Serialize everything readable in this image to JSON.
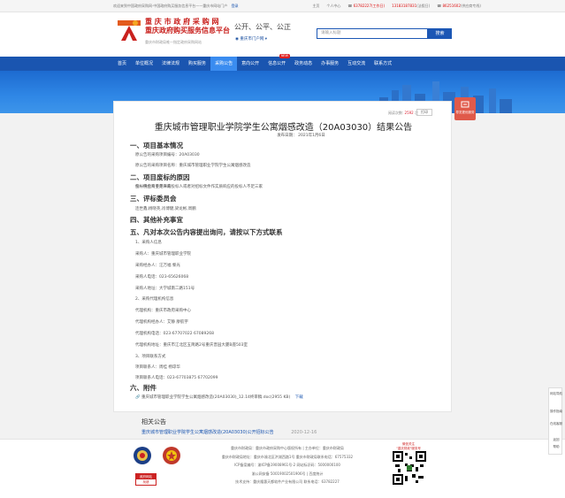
{
  "topbar": {
    "welcome": "欢迎来到中国政府采购网·中国政府购买服务信息平台——重庆市网站门户",
    "login": "登录",
    "links": [
      "主页",
      "个人中心"
    ],
    "tel1": "63782227(工作日)",
    "tel2": "13183187831",
    "tel2_note": "(法假日)",
    "tel3": "86251602",
    "tel3_note": "(供应商专线)"
  },
  "header": {
    "logo_line1": "重 庆 市 政 府 采 购 网",
    "logo_line2": "重庆政府购买服务信息平台",
    "logo_line3": "重庆市财政局唯一指定政府采购网站",
    "slogan": "公开、公平、公正",
    "region": "◉ 重庆市门户网 ▾",
    "search_placeholder": "请输入标题",
    "search_button": "搜索"
  },
  "nav": {
    "items": [
      {
        "label": "首页",
        "active": false
      },
      {
        "label": "单位概况",
        "active": false
      },
      {
        "label": "法律法规",
        "active": false
      },
      {
        "label": "购买服务",
        "active": false
      },
      {
        "label": "采购公告",
        "active": true
      },
      {
        "label": "意向公开",
        "active": false
      },
      {
        "label": "信息公开",
        "active": false,
        "badge": "NEW"
      },
      {
        "label": "政务动态",
        "active": false
      },
      {
        "label": "办事服务",
        "active": false
      },
      {
        "label": "互动交流",
        "active": false
      },
      {
        "label": "联系方式",
        "active": false
      }
    ]
  },
  "article": {
    "views_label": "阅读次数: ",
    "views_count": "2592",
    "views_unit": " 次",
    "print_button": "打印",
    "title": "重庆城市管理职业学院学生公寓烟感改造（20A03030）结果公告",
    "pubdate": "发布日期： 2021年1月6日",
    "sections": [
      {
        "type": "sec",
        "text": "一、项目基本情况"
      },
      {
        "type": "txt",
        "text": "原公告的采购项目编号：20A03030"
      },
      {
        "type": "txt",
        "text": "原公告的采购项目名称：重庆城市管理职业学院学生公寓烟感改造"
      },
      {
        "type": "sec",
        "text": "二、项目废标的原因"
      },
      {
        "type": "txt",
        "text": "投标供应商不足三家"
      },
      {
        "type": "txt",
        "text": "包一符合专业条件的投标人或者对招标文件作实质响应的投标人不足三家"
      },
      {
        "type": "sec",
        "text": "三、评标委员会"
      },
      {
        "type": "txt",
        "text": "连世鑫,杨晓英,肖博健,梁龙彬,周鹏"
      },
      {
        "type": "sec",
        "text": "四、其他补充事宜"
      },
      {
        "type": "sec",
        "text": "五、凡对本次公告内容提出询问，请按以下方式联系"
      },
      {
        "type": "txt2",
        "text": "1、采购人信息"
      },
      {
        "type": "txt2",
        "text": "采购人：重庆城市管理职业学院"
      },
      {
        "type": "txt2",
        "text": "采购经办人：汪万福 黎光"
      },
      {
        "type": "txt2",
        "text": "采购人电话：023-65626068"
      },
      {
        "type": "txt2",
        "text": "采购人地址：大学城南二路151号"
      },
      {
        "type": "txt2",
        "text": "2、采购代理机构信息"
      },
      {
        "type": "txt2",
        "text": "代理机构：重庆市政府采购中心"
      },
      {
        "type": "txt2",
        "text": "代理机构经办人：艾静 廖航宇"
      },
      {
        "type": "txt2",
        "text": "代理机构电话：023-67707022 67089268"
      },
      {
        "type": "txt2",
        "text": "代理机构地址：重庆市江北区五简路2号重庆晋园大厦B座503室"
      },
      {
        "type": "txt2",
        "text": "3、项目联系方式"
      },
      {
        "type": "txt2",
        "text": "项目联系人：周桂 杨琼华"
      },
      {
        "type": "txt2",
        "text": "项目联系人电话：023-67703875 67702099"
      },
      {
        "type": "sec",
        "text": "六、附件"
      }
    ],
    "attachment": {
      "name": "重庆城市管理职业学院学生公寓烟感改造(20A03030)_12.14终审稿.doc(2955 KB)",
      "download": "下载"
    }
  },
  "related": {
    "title": "相关公告",
    "items": [
      {
        "link": "重庆城市管理职业学院学生公寓烟感改造(20A03030)公开招标公告",
        "date": "2020-12-16"
      }
    ]
  },
  "footer": {
    "lines": [
      "重庆市财政局：重庆市政府采购中心版权所有 | 主办单位：重庆市财政局",
      "重庆市财政局地址：重庆市渝北区洪湖西路1号 重庆市财政局联系电话：67575332",
      "ICP备案编号：渝ICP备19008961号-2 网站标识码：5000000100",
      "渝公网安备 50019002501906号 | 百度统计",
      "技术支持：重庆隆惠天都软件产业有限公司 联系电话：63782227"
    ],
    "gov_badge_line1": "政府网站",
    "gov_badge_line2": "找错",
    "qr_label": "微信关注\n\"重庆财政\"服务号"
  },
  "side": {
    "red_label": "导览更优服务",
    "tools": [
      "网站导航",
      "操作指南",
      "在线客服",
      "返回",
      "帮助"
    ]
  },
  "colors": {
    "nav_bg": "#1a55b0",
    "nav_active": "#3a8cf0",
    "brand_red": "#c9211e",
    "link_blue": "#1a55b0"
  }
}
